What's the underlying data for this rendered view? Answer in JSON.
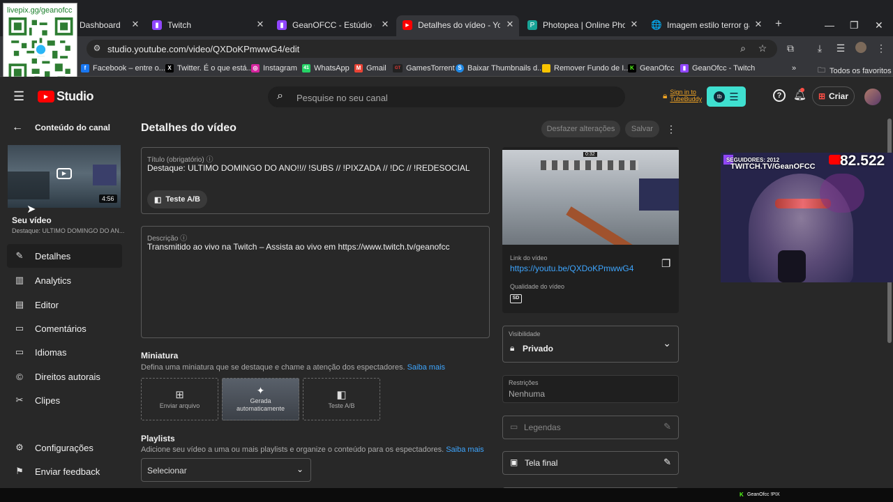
{
  "browser": {
    "tabs": [
      {
        "label": "Dashboard",
        "icon": "dashboard-icon",
        "color": "#8c8c8c"
      },
      {
        "label": "Twitch",
        "icon": "twitch-icon",
        "color": "#9146ff"
      },
      {
        "label": "GeanOFCC - Estúdio de Víde",
        "icon": "twitch-icon",
        "color": "#9146ff"
      },
      {
        "label": "Detalhes do vídeo - YouTube",
        "icon": "youtube-icon",
        "color": "#ff0000"
      },
      {
        "label": "Photopea | Online Photo Edi",
        "icon": "photopea-icon",
        "color": "#18a497"
      },
      {
        "label": "Imagem estilo terror gamer",
        "icon": "globe-icon",
        "color": "#9aa0a6"
      }
    ],
    "url": "studio.youtube.com/video/QXDoKPmwwG4/edit",
    "bookmarks": [
      {
        "label": "Facebook – entre o...",
        "icon": "facebook-icon",
        "color": "#1877f2",
        "glyph": "f"
      },
      {
        "label": "Twitter. É o que está...",
        "icon": "x-icon",
        "color": "#000000",
        "glyph": "X"
      },
      {
        "label": "Instagram",
        "icon": "instagram-icon",
        "color": "#d6249f",
        "glyph": "◎"
      },
      {
        "label": "WhatsApp",
        "icon": "whatsapp-icon",
        "color": "#25d366",
        "glyph": "41"
      },
      {
        "label": "Gmail",
        "icon": "gmail-icon",
        "color": "#ea4335",
        "glyph": "M"
      },
      {
        "label": "GamesTorrent",
        "icon": "gamestorrent-icon",
        "color": "#c62828",
        "glyph": "GT"
      },
      {
        "label": "Baixar Thumbnails d...",
        "icon": "thumbnails-icon",
        "color": "#1e88e5",
        "glyph": "S"
      },
      {
        "label": "Remover Fundo de I...",
        "icon": "remover-fundo-icon",
        "color": "#f9c400",
        "glyph": "■"
      },
      {
        "label": "GeanOfcc",
        "icon": "kick-icon",
        "color": "#53fc18",
        "glyph": "K"
      },
      {
        "label": "GeanOfcc - Twitch",
        "icon": "twitch-icon",
        "color": "#9146ff",
        "glyph": "▮"
      }
    ],
    "all_bookmarks": "Todos os favoritos"
  },
  "overlay_qr": {
    "text": "livepix.gg/geanofcc"
  },
  "studio": {
    "logo_text": "Studio",
    "search_placeholder": "Pesquise no seu canal",
    "tubebuddy": "Sign in to TubeBuddy",
    "create_label": "Criar"
  },
  "leftnav": {
    "back_label": "Conteúdo do canal",
    "thumb_duration": "4:56",
    "your_video": "Seu vídeo",
    "video_subtitle": "Destaque: ULTIMO DOMINGO DO AN...",
    "items": [
      {
        "label": "Detalhes",
        "icon": "pencil-icon"
      },
      {
        "label": "Analytics",
        "icon": "analytics-icon"
      },
      {
        "label": "Editor",
        "icon": "editor-icon"
      },
      {
        "label": "Comentários",
        "icon": "comments-icon"
      },
      {
        "label": "Idiomas",
        "icon": "subtitles-icon"
      },
      {
        "label": "Direitos autorais",
        "icon": "copyright-icon"
      },
      {
        "label": "Clipes",
        "icon": "scissors-icon"
      }
    ],
    "settings": "Configurações",
    "feedback": "Enviar feedback"
  },
  "main": {
    "page_title": "Detalhes do vídeo",
    "undo_label": "Desfazer alterações",
    "save_label": "Salvar",
    "title_label": "Título (obrigatório)",
    "title_value": "Destaque: ULTIMO DOMINGO DO ANO!!// !SUBS // !PIXZADA // !DC // !REDESOCIAL",
    "ab_label": "Teste A/B",
    "desc_label": "Descrição",
    "desc_value": "Transmitido ao vivo na Twitch – Assista ao vivo em https://www.twitch.tv/geanofcc",
    "thumb_heading": "Miniatura",
    "thumb_sub": "Defina uma miniatura que se destaque e chame a atenção dos espectadores.",
    "learn_more": "Saiba mais",
    "thumb_upload": "Enviar arquivo",
    "thumb_auto": "Gerada automaticamente",
    "thumb_ab": "Teste A/B",
    "playlists_heading": "Playlists",
    "playlists_sub": "Adicione seu vídeo a uma ou mais playlists e organize o conteúdo para os espectadores.",
    "playlist_select": "Selecionar"
  },
  "right": {
    "preview_timer": "0:32",
    "link_label": "Link do vídeo",
    "link_value": "https://youtu.be/QXDoKPmwwG4",
    "quality_label": "Qualidade do vídeo",
    "quality_value": "SD",
    "visibility_label": "Visibilidade",
    "visibility_value": "Privado",
    "restrictions_label": "Restrições",
    "restrictions_value": "Nenhuma",
    "subtitles_label": "Legendas",
    "endscreen_label": "Tela final"
  },
  "stream_overlay": {
    "followers": "SEGUIDORES: 2012",
    "channel": "TWITCH.TV/GeanOFCC",
    "count": "82.522",
    "footer": "GeanOfcc !PIX"
  },
  "colors": {
    "accent_blue": "#3ea6ff",
    "youtube_red": "#ff0000",
    "twitch_purple": "#9146ff",
    "tubebuddy_teal": "#3fe0d0"
  }
}
